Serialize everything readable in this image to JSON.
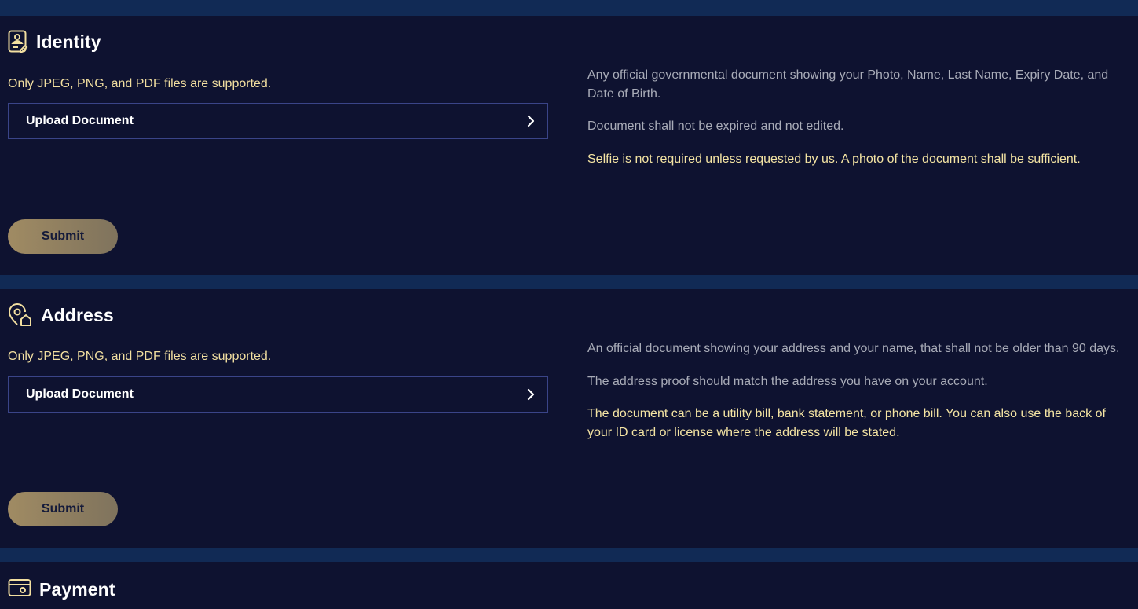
{
  "colors": {
    "band": "#112a55",
    "panel": "#0e1230",
    "accent_text": "#f2dfa0",
    "muted_text": "#a9acb8",
    "upload_border": "#3a4488",
    "submit_gradient_start": "#a08b63",
    "submit_gradient_end": "#7f735d"
  },
  "identity": {
    "title": "Identity",
    "icon": "id-card-icon",
    "supported_note": "Only JPEG, PNG, and PDF files are supported.",
    "upload_label": "Upload Document",
    "submit_label": "Submit",
    "info": [
      "Any official governmental document showing your Photo, Name, Last Name, Expiry Date, and Date of Birth.",
      "Document shall not be expired and not edited.",
      "Selfie is not required unless requested by us. A photo of the document shall be sufficient."
    ]
  },
  "address": {
    "title": "Address",
    "icon": "location-home-icon",
    "supported_note": "Only JPEG, PNG, and PDF files are supported.",
    "upload_label": "Upload Document",
    "submit_label": "Submit",
    "info": [
      "An official document showing your address and your name, that shall not be older than 90 days.",
      "The address proof should match the address you have on your account.",
      "The document can be a utility bill, bank statement, or phone bill. You can also use the back of your ID card or license where the address will be stated."
    ]
  },
  "payment": {
    "title": "Payment",
    "icon": "payment-card-icon"
  }
}
